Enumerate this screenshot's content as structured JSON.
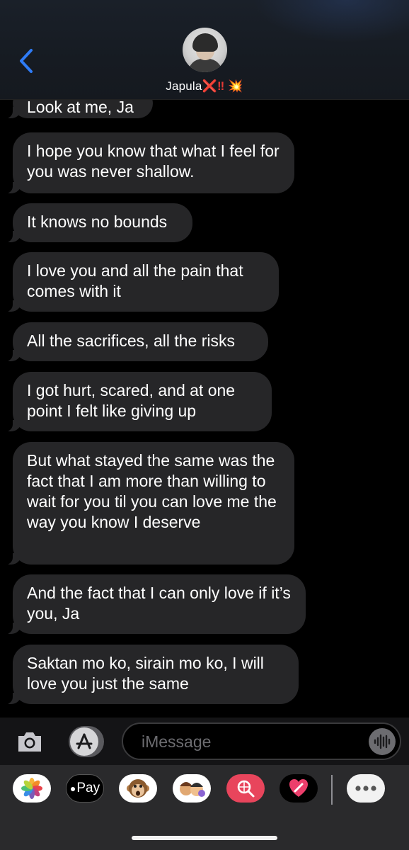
{
  "header": {
    "contact_name": "Japula",
    "contact_suffix_x": "❌",
    "contact_suffix_bang": "‼",
    "contact_suffix_burst": "💥",
    "back_icon": "chevron-left-icon"
  },
  "messages": [
    {
      "text": "Look at me, Ja"
    },
    {
      "text": "I hope you know that what I feel for you was never shallow."
    },
    {
      "text": "It knows no bounds"
    },
    {
      "text": "I love you and all the pain that comes with it"
    },
    {
      "text": "All the sacrifices, all the risks"
    },
    {
      "text": "I got hurt, scared, and at one point I felt like giving up"
    },
    {
      "text": "But what stayed the same was the fact that I am more than willing to wait for you til you can love me the way you know I deserve"
    },
    {
      "text": "And the fact that I can only love if it’s you, Ja"
    },
    {
      "text": "Saktan mo ko, sirain mo ko, I will love you just the same"
    }
  ],
  "input": {
    "placeholder": "iMessage",
    "camera_icon": "camera-icon",
    "apps_icon": "app-store-icon",
    "audio_icon": "waveform-icon"
  },
  "app_drawer": {
    "apps": [
      {
        "name": "photos-app-icon"
      },
      {
        "name": "apple-pay-app-icon",
        "label": "Pay"
      },
      {
        "name": "animoji-app-icon"
      },
      {
        "name": "memoji-app-icon"
      },
      {
        "name": "image-search-app-icon"
      },
      {
        "name": "digital-touch-app-icon"
      },
      {
        "name": "more-apps-icon"
      }
    ]
  },
  "colors": {
    "accent": "#2f7cf6",
    "bubble": "#262628",
    "background": "#000000",
    "header": "#181d24"
  }
}
